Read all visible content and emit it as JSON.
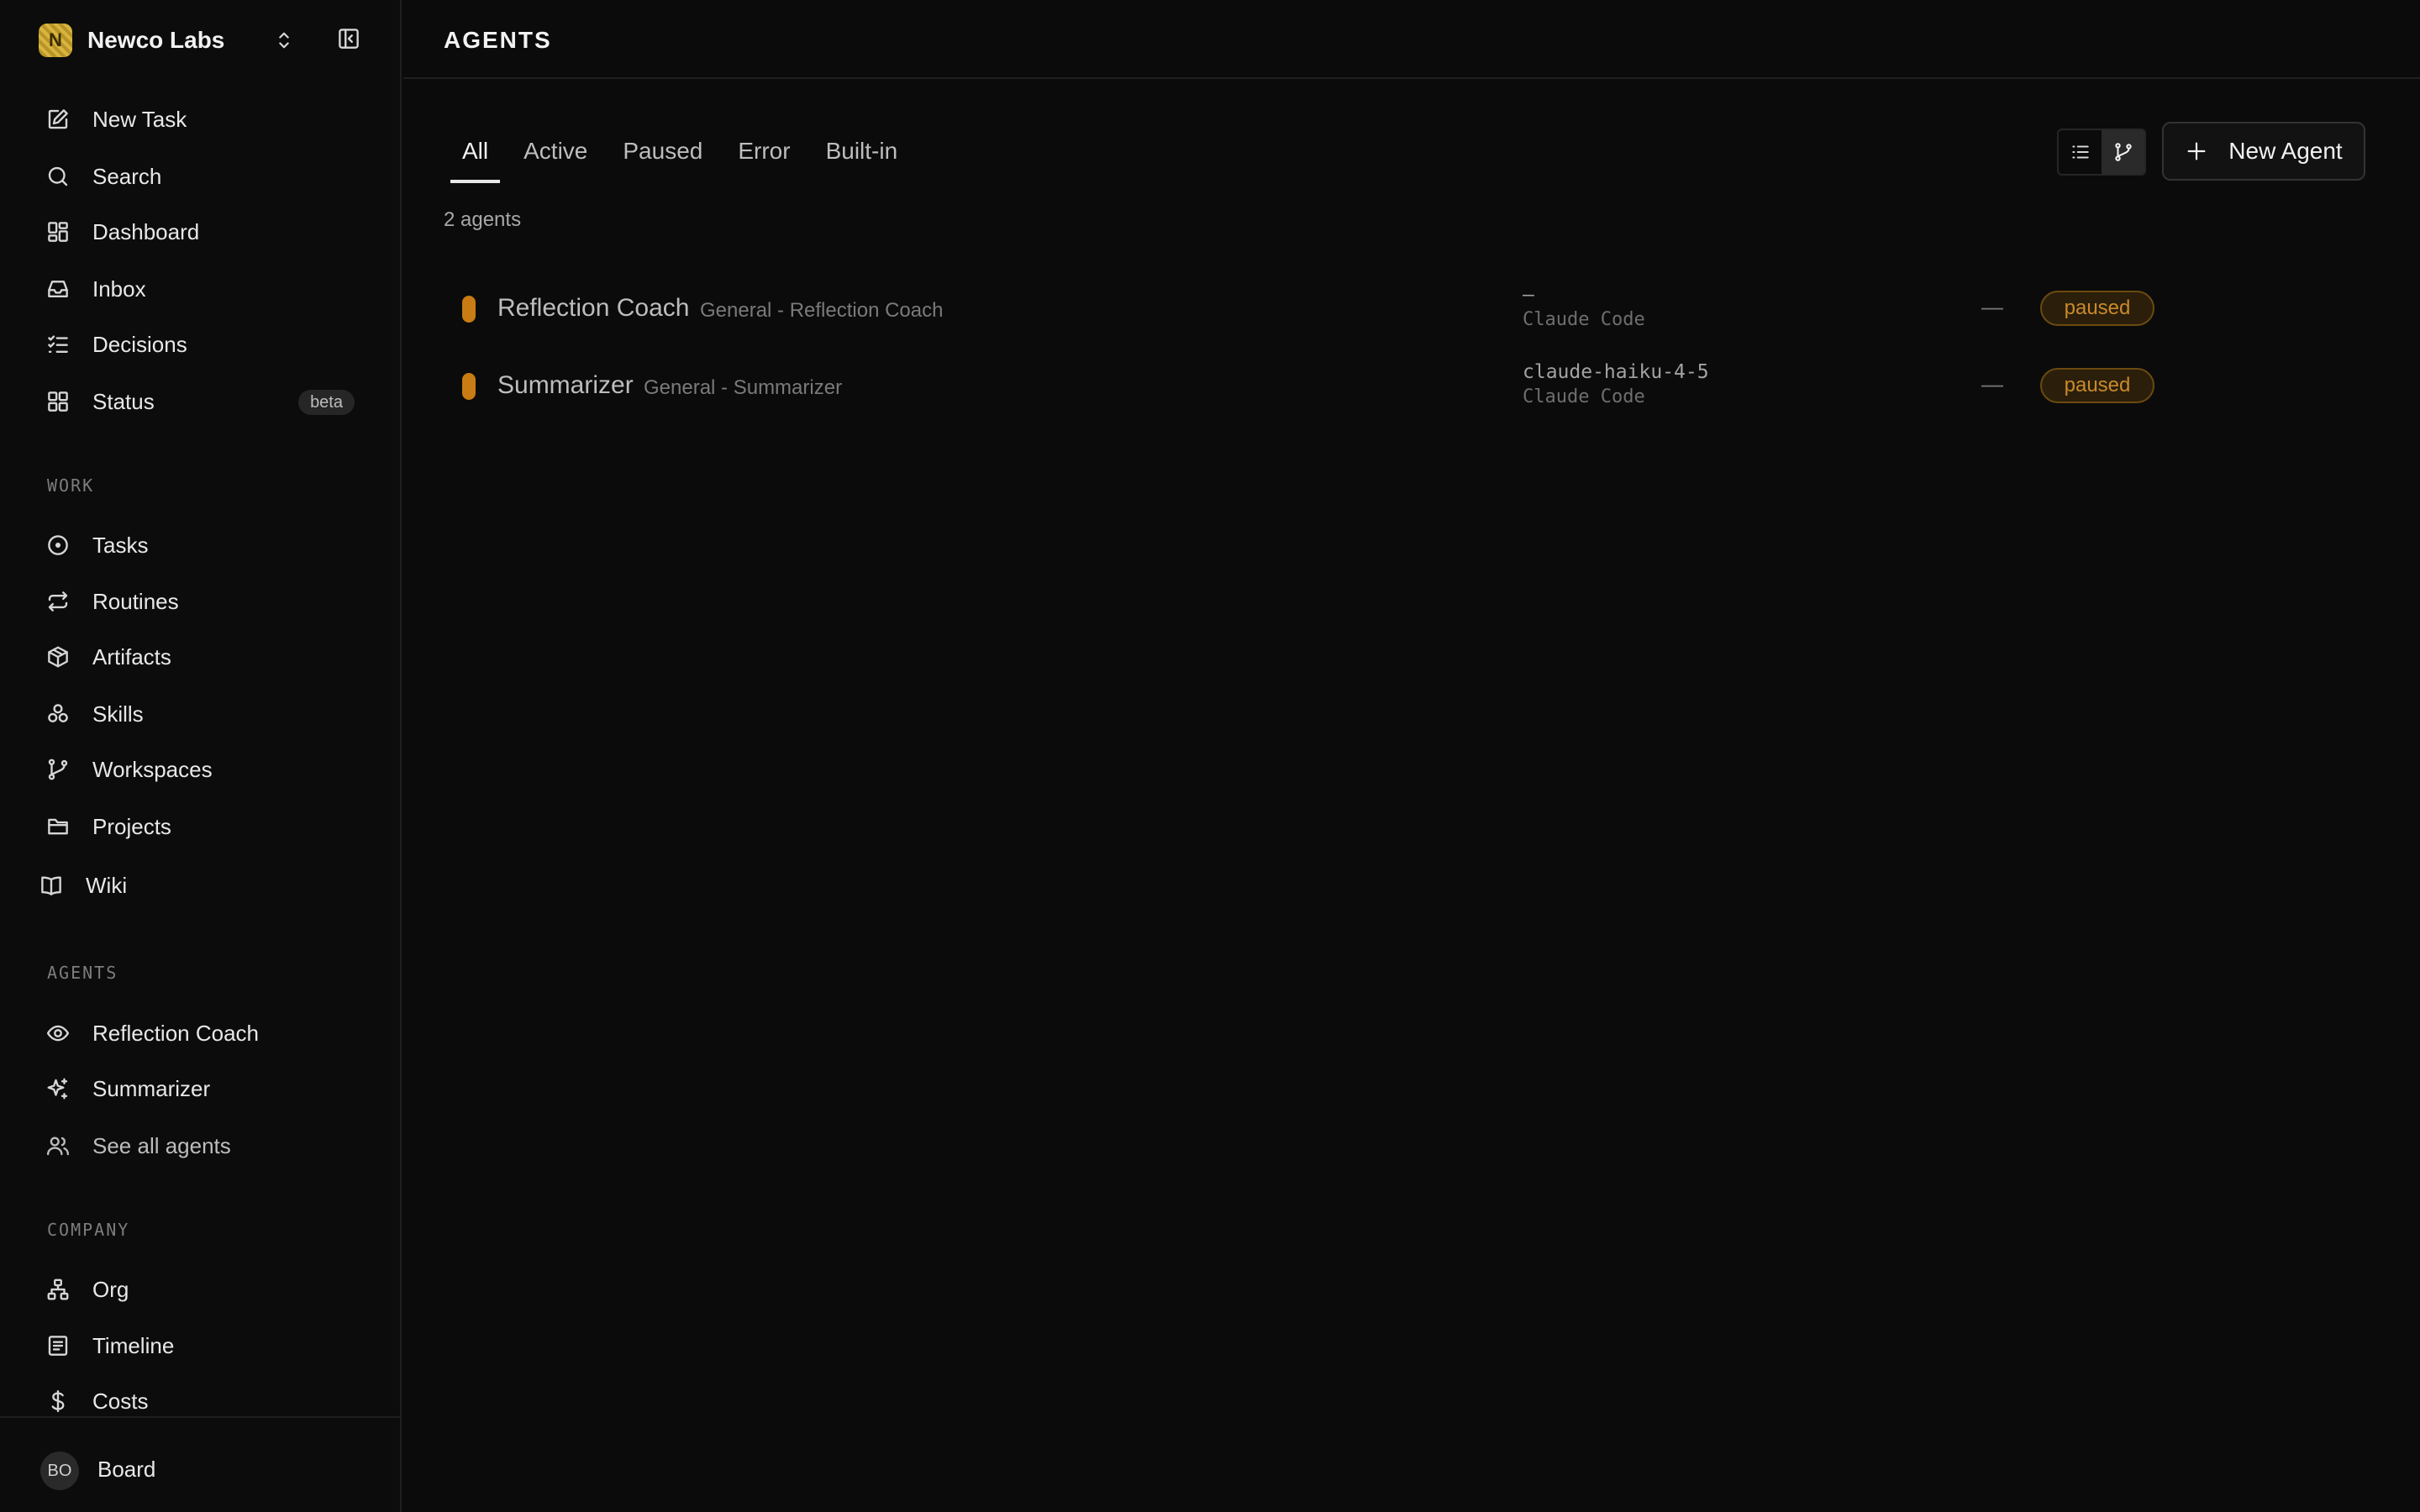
{
  "workspace": {
    "initial": "N",
    "name": "Newco Labs"
  },
  "nav": {
    "primary": [
      {
        "label": "New Task",
        "icon": "pencil-square-icon"
      },
      {
        "label": "Search",
        "icon": "search-icon"
      },
      {
        "label": "Dashboard",
        "icon": "dashboard-icon"
      },
      {
        "label": "Inbox",
        "icon": "inbox-icon"
      },
      {
        "label": "Decisions",
        "icon": "checklist-icon"
      },
      {
        "label": "Status",
        "icon": "grid-icon",
        "badge": "beta"
      }
    ],
    "work_label": "WORK",
    "work": [
      {
        "label": "Tasks",
        "icon": "circle-dot-icon"
      },
      {
        "label": "Routines",
        "icon": "repeat-icon"
      },
      {
        "label": "Artifacts",
        "icon": "box-icon"
      },
      {
        "label": "Skills",
        "icon": "skills-icon"
      },
      {
        "label": "Workspaces",
        "icon": "git-branch-icon"
      },
      {
        "label": "Projects",
        "icon": "folder-icon"
      },
      {
        "label": "Wiki",
        "icon": "book-icon"
      }
    ],
    "agents_label": "AGENTS",
    "agents": [
      {
        "label": "Reflection Coach",
        "icon": "eye-icon"
      },
      {
        "label": "Summarizer",
        "icon": "sparkles-icon"
      },
      {
        "label": "See all agents",
        "icon": "users-icon"
      }
    ],
    "company_label": "COMPANY",
    "company": [
      {
        "label": "Org",
        "icon": "org-chart-icon"
      },
      {
        "label": "Timeline",
        "icon": "timeline-icon"
      },
      {
        "label": "Costs",
        "icon": "dollar-icon"
      }
    ]
  },
  "footer": {
    "avatar_initials": "BO",
    "label": "Board"
  },
  "page": {
    "title": "AGENTS"
  },
  "tabs": [
    {
      "label": "All",
      "active": true
    },
    {
      "label": "Active",
      "active": false
    },
    {
      "label": "Paused",
      "active": false
    },
    {
      "label": "Error",
      "active": false
    },
    {
      "label": "Built-in",
      "active": false
    }
  ],
  "agent_count": "2 agents",
  "new_agent_label": "New Agent",
  "agents": [
    {
      "name": "Reflection Coach",
      "sub": "General - Reflection Coach",
      "model": "—",
      "runtime": "Claude Code",
      "last_run": "—",
      "status": "paused",
      "status_color": "#c97c13"
    },
    {
      "name": "Summarizer",
      "sub": "General - Summarizer",
      "model": "claude-haiku-4-5",
      "runtime": "Claude Code",
      "last_run": "—",
      "status": "paused",
      "status_color": "#c97c13"
    }
  ]
}
